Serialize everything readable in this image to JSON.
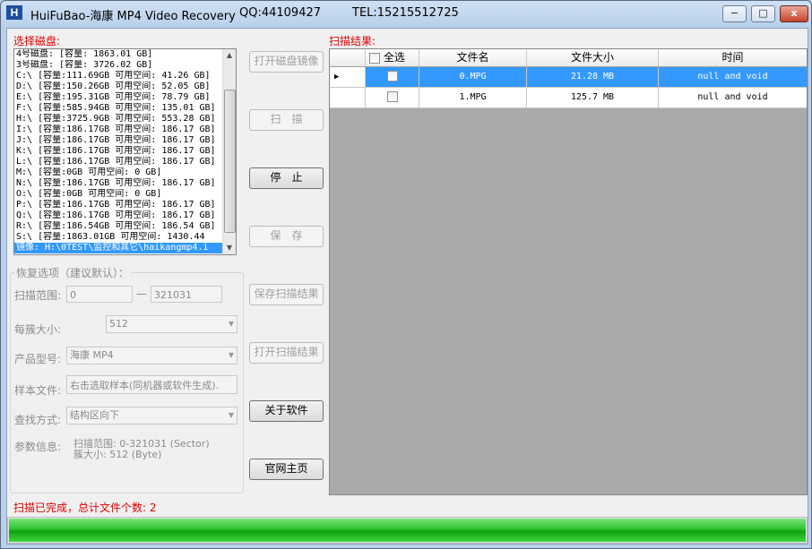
{
  "window": {
    "app_name": "HuiFuBao-海康 MP4 Video Recovery",
    "qq": "QQ:44109427",
    "tel": "TEL:15215512725",
    "minimize": "−",
    "maximize": "□",
    "close": "x"
  },
  "disk_panel": {
    "label": "选择磁盘:",
    "items": [
      "4号磁盘: [容量: 1863.01 GB]",
      "3号磁盘: [容量: 3726.02 GB]",
      "C:\\ [容量:111.69GB 可用空间: 41.26 GB]",
      "D:\\ [容量:150.26GB 可用空间: 52.05 GB]",
      "E:\\ [容量:195.31GB 可用空间: 78.79 GB]",
      "F:\\ [容量:585.94GB 可用空间: 135.01 GB]",
      "H:\\ [容量:3725.9GB 可用空间: 553.28 GB]",
      "I:\\ [容量:186.17GB 可用空间: 186.17 GB]",
      "J:\\ [容量:186.17GB 可用空间: 186.17 GB]",
      "K:\\ [容量:186.17GB 可用空间: 186.17 GB]",
      "L:\\ [容量:186.17GB 可用空间: 186.17 GB]",
      "M:\\ [容量:0GB 可用空间: 0 GB]",
      "N:\\ [容量:186.17GB 可用空间: 186.17 GB]",
      "O:\\ [容量:0GB 可用空间: 0 GB]",
      "P:\\ [容量:186.17GB 可用空间: 186.17 GB]",
      "Q:\\ [容量:186.17GB 可用空间: 186.17 GB]",
      "R:\\ [容量:186.54GB 可用空间: 186.54 GB]",
      "S:\\ [容量:1863.01GB 可用空间: 1430.44",
      "镜像: H:\\0TEST\\监控和其它\\haikangmp4.i"
    ],
    "selected_index": 18
  },
  "buttons": {
    "open_image": "打开磁盘镜像",
    "scan": "扫　描",
    "stop": "停　止",
    "save": "保　存",
    "save_results": "保存扫描结果",
    "open_results": "打开扫描结果",
    "about": "关于软件",
    "homepage": "官网主页"
  },
  "options": {
    "group_title": "恢复选项（建议默认）：",
    "range_label": "扫描范围:",
    "range_start": "0",
    "range_sep": "—",
    "range_end": "321031",
    "cluster_label": "每簇大小:",
    "cluster_value": "512",
    "model_label": "产品型号:",
    "model_value": "海康 MP4",
    "sample_label": "样本文件:",
    "sample_value": "右击选取样本(同机器或软件生成).",
    "find_label": "查找方式:",
    "find_value": "结构区向下",
    "param_label": "参数信息:",
    "param_line1": "扫描范围: 0-321031 (Sector)",
    "param_line2": "簇大小: 512 (Byte)"
  },
  "results": {
    "label": "扫描结果:",
    "columns": {
      "select_all": "全选",
      "filename": "文件名",
      "size": "文件大小",
      "time": "时间"
    },
    "rows": [
      {
        "filename": "0.MPG",
        "size": "21.28 MB",
        "time": "null and void",
        "selected": true
      },
      {
        "filename": "1.MPG",
        "size": "125.7 MB",
        "time": "null and void",
        "selected": false
      }
    ]
  },
  "status": {
    "text": "扫描已完成，总计文件个数: 2",
    "progress_fraction": 1.0
  }
}
